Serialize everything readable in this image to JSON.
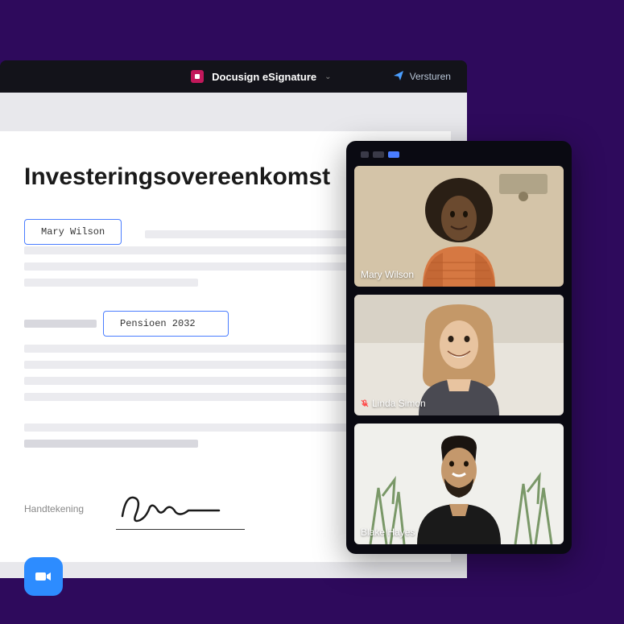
{
  "app": {
    "title": "Docusign eSignature",
    "send_label": "Versturen"
  },
  "document": {
    "heading": "Investeringsovereenkomst",
    "field1": "Mary Wilson",
    "field2": "Pensioen 2032",
    "signature_label": "Handtekening"
  },
  "video": {
    "participants": [
      {
        "name": "Mary Wilson",
        "muted": false
      },
      {
        "name": "Linda Simon",
        "muted": true
      },
      {
        "name": "Blake Hayes",
        "muted": false
      }
    ]
  }
}
